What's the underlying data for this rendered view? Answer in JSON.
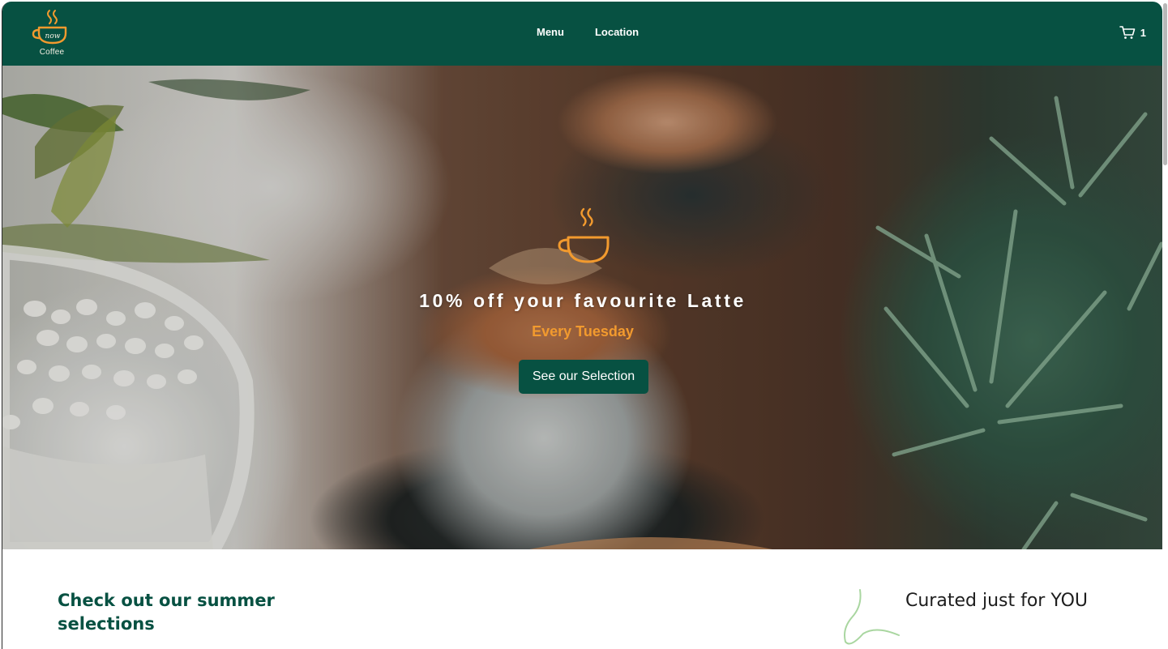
{
  "brand": {
    "logo_text": "now",
    "caption": "Coffee",
    "primary_color": "#075142",
    "accent_color": "#f29a2e"
  },
  "nav": {
    "items": [
      {
        "label": "Menu"
      },
      {
        "label": "Location"
      }
    ]
  },
  "cart": {
    "icon": "cart-icon",
    "count": "1"
  },
  "hero": {
    "icon": "coffee-cup-icon",
    "title": "10% off your favourite Latte",
    "subtitle": "Every Tuesday",
    "button_label": "See our Selection"
  },
  "summer": {
    "title": "Check out our summer selections"
  },
  "curated": {
    "text": "Curated just for YOU"
  }
}
